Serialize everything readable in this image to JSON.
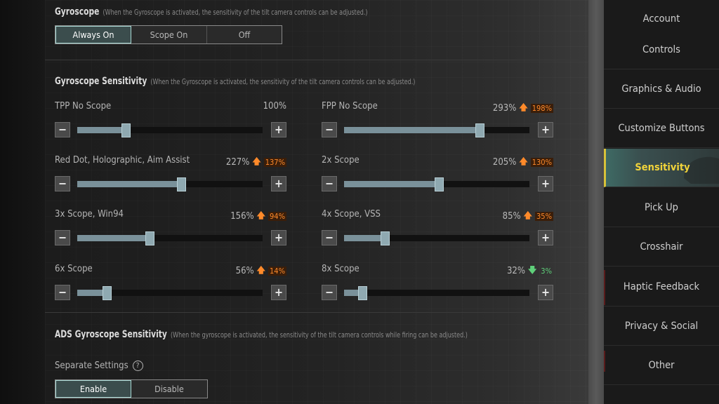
{
  "gyroscope": {
    "title": "Gyroscope",
    "hint": "(When the Gyroscope is activated, the sensitivity of the tilt camera controls can be adjusted.)",
    "options": [
      "Always On",
      "Scope On",
      "Off"
    ],
    "selected": "Always On"
  },
  "gyro_sensitivity": {
    "title": "Gyroscope Sensitivity",
    "hint": "(When the Gyroscope is activated, the sensitivity of the tilt camera controls can be adjusted.)",
    "sliders": [
      {
        "label": "TPP No Scope",
        "value": "100%",
        "fraction": 0.26,
        "delta": null,
        "direction": null
      },
      {
        "label": "FPP No Scope",
        "value": "293%",
        "fraction": 0.73,
        "delta": "198%",
        "direction": "up"
      },
      {
        "label": "Red Dot, Holographic, Aim Assist",
        "value": "227%",
        "fraction": 0.56,
        "delta": "137%",
        "direction": "up"
      },
      {
        "label": "2x Scope",
        "value": "205%",
        "fraction": 0.51,
        "delta": "130%",
        "direction": "up"
      },
      {
        "label": "3x Scope, Win94",
        "value": "156%",
        "fraction": 0.39,
        "delta": "94%",
        "direction": "up"
      },
      {
        "label": "4x Scope, VSS",
        "value": "85%",
        "fraction": 0.22,
        "delta": "35%",
        "direction": "up"
      },
      {
        "label": "6x Scope",
        "value": "56%",
        "fraction": 0.16,
        "delta": "14%",
        "direction": "up"
      },
      {
        "label": "8x Scope",
        "value": "32%",
        "fraction": 0.1,
        "delta": "3%",
        "direction": "down"
      }
    ],
    "minus_symbol": "−",
    "plus_symbol": "+"
  },
  "ads": {
    "title": "ADS Gyroscope Sensitivity",
    "hint": "(When the gyroscope is activated, the sensitivity of the tilt camera controls while firing can be adjusted.)",
    "separate_label": "Separate Settings",
    "help_symbol": "?",
    "options": [
      "Enable",
      "Disable"
    ],
    "selected": "Enable"
  },
  "nav": {
    "items": [
      "Account",
      "Controls",
      "Graphics & Audio",
      "Customize Buttons",
      "Sensitivity",
      "Pick Up",
      "Crosshair",
      "Haptic Feedback",
      "Privacy & Social",
      "Other"
    ],
    "active": "Sensitivity"
  },
  "colors": {
    "accent_active_text": "#f2d43a",
    "delta_up": "#ff8a2a",
    "delta_down": "#5fd07a",
    "segment_active_border": "#a8d8d4"
  },
  "arrows": {
    "up": "🡅",
    "down": "🡇"
  }
}
